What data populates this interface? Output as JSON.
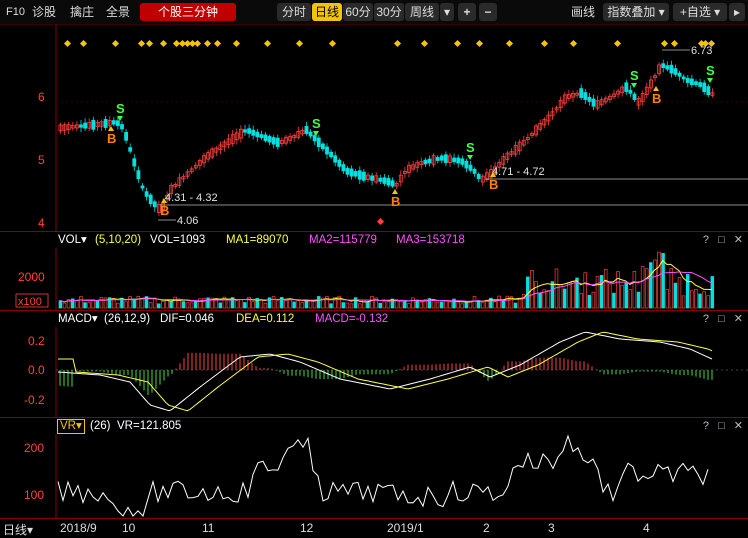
{
  "toolbar": {
    "f10": "F10",
    "diagnose": "诊股",
    "chart_view": "擒庄",
    "overview": "全景",
    "active_tab": "个股三分钟",
    "periods": [
      "分时",
      "日线",
      "60分",
      "30分",
      "周线"
    ],
    "active_period": "日线",
    "period_dropdown": "▾",
    "zoom_in": "+",
    "zoom_out": "−",
    "draw_line": "画线",
    "index_overlay": "指数叠加",
    "add_watch": "+自选"
  },
  "main_chart": {
    "y_ticks": [
      "6",
      "5",
      "4"
    ],
    "high_label": "6.73",
    "low_label": "4.06",
    "range1": "4.31 - 4.32",
    "range2": "4.71 - 4.72",
    "buy_mark": "B",
    "sell_mark": "S"
  },
  "vol_panel": {
    "title": "VOL",
    "params": "(5,10,20)",
    "vol": "VOL=1093",
    "ma1": "MA1=89070",
    "ma2": "MA2=115779",
    "ma3": "MA3=153718",
    "y_tick": "2000",
    "unit": "x100",
    "controls": "? □ ✕"
  },
  "macd_panel": {
    "title": "MACD",
    "params": "(26,12,9)",
    "dif": "DIF=0.046",
    "dea": "DEA=0.112",
    "macd": "MACD=-0.132",
    "y_ticks": [
      "0.2",
      "0.0",
      "-0.2"
    ],
    "controls": "? □ ✕"
  },
  "vr_panel": {
    "title": "VR",
    "params": "(26)",
    "vr": "VR=121.805",
    "y_ticks": [
      "200",
      "100"
    ],
    "controls": "? □ ✕"
  },
  "x_axis": {
    "period_label": "日线",
    "labels": [
      "2018/9",
      "10",
      "11",
      "12",
      "2019/1",
      "2",
      "3",
      "4"
    ]
  },
  "colors": {
    "up": "#ff4040",
    "down": "#00e0e0",
    "ma_white": "#ffffff",
    "ma_yellow": "#ffff40",
    "ma_pink": "#ff50ff",
    "signal_yellow": "#f5c400",
    "sell_green": "#40ff40",
    "buy_orange": "#ff8000"
  }
}
